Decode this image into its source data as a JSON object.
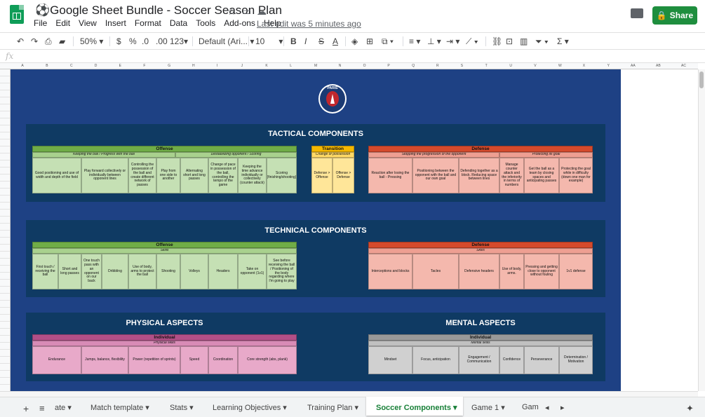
{
  "doc": {
    "title": "Google Sheet Bundle - Soccer Season Plan",
    "last_edit": "Last edit was 5 minutes ago",
    "share": "Share",
    "title_icon": "soccer-ball-icon"
  },
  "menu": [
    "File",
    "Edit",
    "View",
    "Insert",
    "Format",
    "Data",
    "Tools",
    "Add-ons",
    "Help"
  ],
  "toolbar": {
    "zoom": "50%",
    "currency": "$",
    "percent": "%",
    "dec_less": ".0",
    "dec_more": ".00",
    "format": "123",
    "font": "Default (Ari...",
    "size": "10",
    "bold": "B",
    "italic": "I",
    "strike": "S",
    "color_a": "A",
    "sigma": "Σ"
  },
  "formula": {
    "fx": "fx"
  },
  "columns": [
    "A",
    "B",
    "C",
    "D",
    "E",
    "F",
    "G",
    "H",
    "I",
    "J",
    "K",
    "L",
    "M",
    "N",
    "O",
    "P",
    "Q",
    "R",
    "S",
    "T",
    "U",
    "V",
    "W",
    "X",
    "Y"
  ],
  "columns_right": [
    "AA",
    "AB",
    "AC"
  ],
  "crest": {
    "text": "PARIS"
  },
  "tactical": {
    "title": "TACTICAL COMPONENTS",
    "offense": {
      "header": "Offense",
      "groups": [
        "Keeping the ball / Progress with the ball",
        "Destabilizing opponent / Scoring"
      ],
      "cells": [
        "Good positioning and use of width and depth of the field",
        "Play forward collectively or individually between opponent lines",
        "Controlling the possession of the ball and create different network of passes",
        "Play from one side to another",
        "Alternating short and long passes",
        "Change of pace in possession of the ball, controlling the tempo of the game",
        "Keeping the time advance individually or collectively (counter attack)",
        "Scoring (finishing/shooting)"
      ]
    },
    "transition": {
      "header": "Transition",
      "group": "Change of possession",
      "cells": [
        "Defense > Offense",
        "Offense > Defense"
      ]
    },
    "defense": {
      "header": "Defense",
      "groups": [
        "Stopping the progression of the opponent",
        "Protecting its goal"
      ],
      "cells": [
        "Reaction after losing the ball - Pressing",
        "Positioning between the opponent with the ball and our own goal",
        "Defending together as a block. Reducing space between lines",
        "Manage counter attack and the inferiority in terms of numbers",
        "Get the ball as a team by closing spaces and anticipating passes",
        "Protecting the goal while in difficulty (down one man for example)"
      ]
    }
  },
  "technical": {
    "title": "TECHNICAL COMPONENTS",
    "offense": {
      "header": "Offense",
      "group": "Skills",
      "cells": [
        "First touch / receiving the ball",
        "Short and long passes",
        "One touch pass with an opponent on our back",
        "Dribbling",
        "Use of body, arms to protect the ball",
        "Shooting",
        "Volleys",
        "Headers",
        "Take on opponent (1v1)",
        "See before receiving the ball / Positioning of the body regarding where I'm going to play"
      ]
    },
    "defense": {
      "header": "Defense",
      "group": "Skills",
      "cells": [
        "Interceptions and blocks",
        "Tacles",
        "Defensive headers",
        "Use of body, arms.",
        "Pressing and getting close to opponent without fouling",
        "1v1 defense"
      ]
    }
  },
  "physical": {
    "title": "PHYSICAL ASPECTS",
    "header": "Individual",
    "group": "Physical skills",
    "cells": [
      "Endurance",
      "Jumps, balance, flexibility",
      "Power (repetition of sprints)",
      "Speed",
      "Coordination",
      "Core strength (abs, plank)"
    ]
  },
  "mental": {
    "title": "MENTAL ASPECTS",
    "header": "Individual",
    "group": "Mental skills",
    "cells": [
      "Mindset",
      "Focus, anticipation",
      "Engagement / Communication",
      "Confidence",
      "Perseverance",
      "Determination / Motivation"
    ]
  },
  "tabs": [
    "ate",
    "Match template",
    "Stats",
    "Learning Objectives",
    "Training Plan",
    "Soccer Components",
    "Game 1",
    "Gam"
  ],
  "active_tab": "Soccer Components",
  "colors": {
    "canvas": "#1e4184",
    "panel": "#0f3a63",
    "accent": "#1e8e3e",
    "active_tab_text": "#188038"
  }
}
